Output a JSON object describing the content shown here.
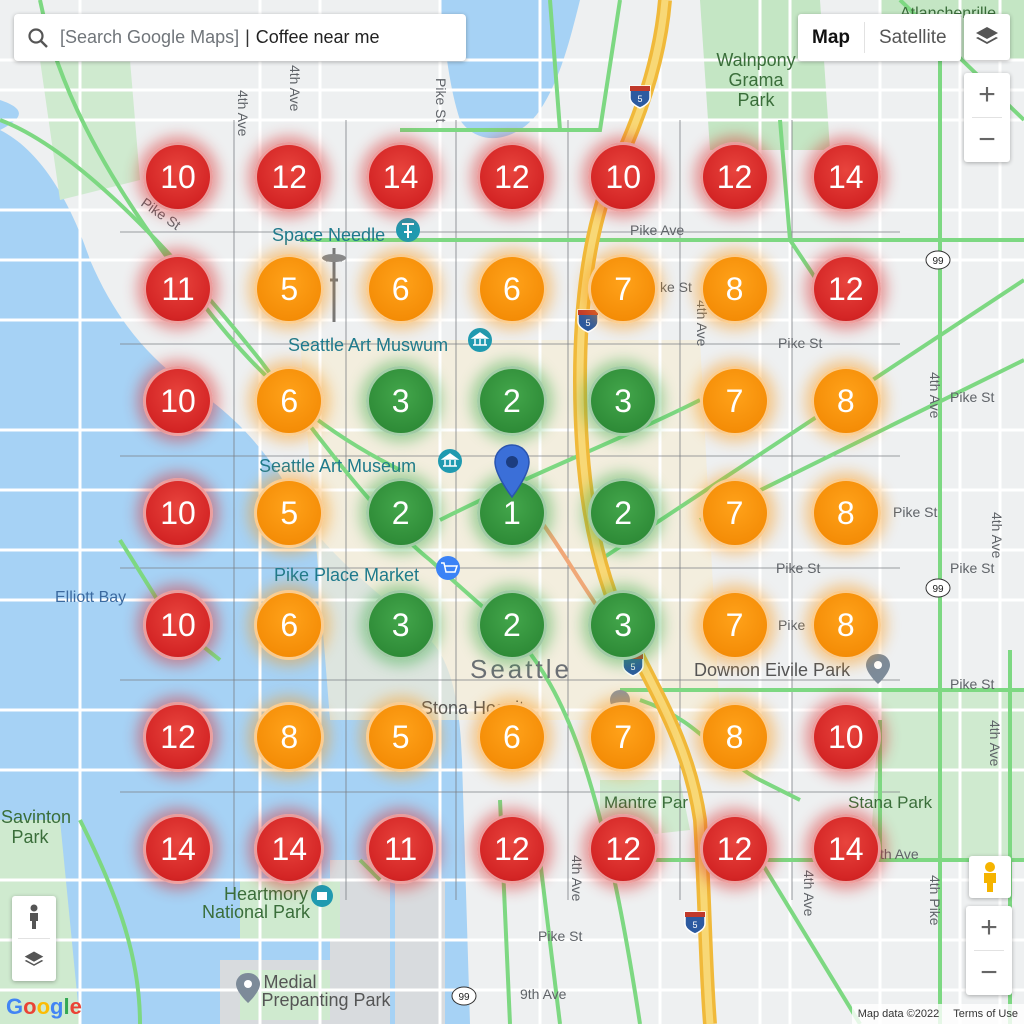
{
  "search": {
    "placeholder": "[Search Google Maps]",
    "separator": "|",
    "query": "Coffee near me"
  },
  "map_type": {
    "map_label": "Map",
    "satellite_label": "Satellite",
    "active": "Map"
  },
  "zoom_top": {
    "in_label": "+",
    "out_label": "−"
  },
  "zoom_bottom": {
    "in_label": "+",
    "out_label": "−"
  },
  "branding": {
    "google_logo": "Google",
    "map_data": "Map data ©2022",
    "terms": "Terms of Use"
  },
  "colors": {
    "rank_high": "#2e8b37",
    "rank_mid": "#f48c06",
    "rank_low": "#d42525",
    "water": "#a6d2f5",
    "park": "#c4e6c4",
    "traffic": "#7dd882",
    "highway": "#f5c542",
    "pin": "#3b6fd8"
  },
  "ranking_grid": {
    "rows": [
      [
        10,
        12,
        14,
        12,
        10,
        12,
        14
      ],
      [
        11,
        5,
        6,
        6,
        7,
        8,
        12
      ],
      [
        10,
        6,
        3,
        2,
        3,
        7,
        8
      ],
      [
        10,
        5,
        2,
        1,
        2,
        7,
        8
      ],
      [
        10,
        6,
        3,
        2,
        3,
        7,
        8
      ],
      [
        12,
        8,
        5,
        6,
        7,
        8,
        10
      ],
      [
        14,
        14,
        11,
        12,
        12,
        12,
        14
      ]
    ],
    "green_max": 3,
    "orange_max": 8
  },
  "map_labels": {
    "seattle": "Seattle",
    "elliott_bay": "Elliott Bay",
    "space_needle": "Space Needle",
    "seattle_art_muswum": "Seattle Art Muswum",
    "seattle_art_museum": "Seattle Art Museum",
    "pike_place_market": "Pike Place Market",
    "walnpony_grama_park": "Walnpony\nGrama\nPark",
    "atlanchenrille": "Atlanchenrille",
    "downon_eivile_park": "Downon Eivile Park",
    "mantre_par": "Mantre Par",
    "stana_park": "Stana Park",
    "savinton_park": "Savinton\nPark",
    "heartmory_park": "Heartmory\nNational Park",
    "medial_prepanting_park": "Medial\nPrepanting Park",
    "stona_hospit": "ro Stona    Hospit",
    "street_4th_ave_a": "4th Ave",
    "street_4th_ave_b": "4th Ave",
    "street_pike_st_a": "Pike St",
    "street_pike_ave": "Pike Ave",
    "street_pike_st_b": "Pike St",
    "street_pike_st_c": "Pike St",
    "street_pike_st_d": "Pike St",
    "street_pike_st_e": "Pike St",
    "street_pike_st_f": "Pike St",
    "street_pike_st_g": "Pike St",
    "street_pike_st_h": "Pike St",
    "street_pike_st_i": "Pike St",
    "street_4th_ave_c": "4th Ave",
    "street_4th_ave_d": "4th Ave",
    "street_4th_ave_e": "4th Ave",
    "street_4th_ave_f": "4th Ave",
    "street_4th_ave_g": "4th Ave",
    "street_4th_ave_h": "4th Ave",
    "street_9th_ave": "9th Ave",
    "street_th_ave": "th Ave",
    "street_ke_st": "ke St",
    "street_pike": "Pike",
    "street_4th_pike": "4th Pike",
    "shield_5a": "5",
    "shield_5b": "5",
    "shield_5c": "5",
    "shield_5d": "5",
    "shield_99a": "99",
    "shield_99b": "99",
    "shield_99c": "99"
  }
}
